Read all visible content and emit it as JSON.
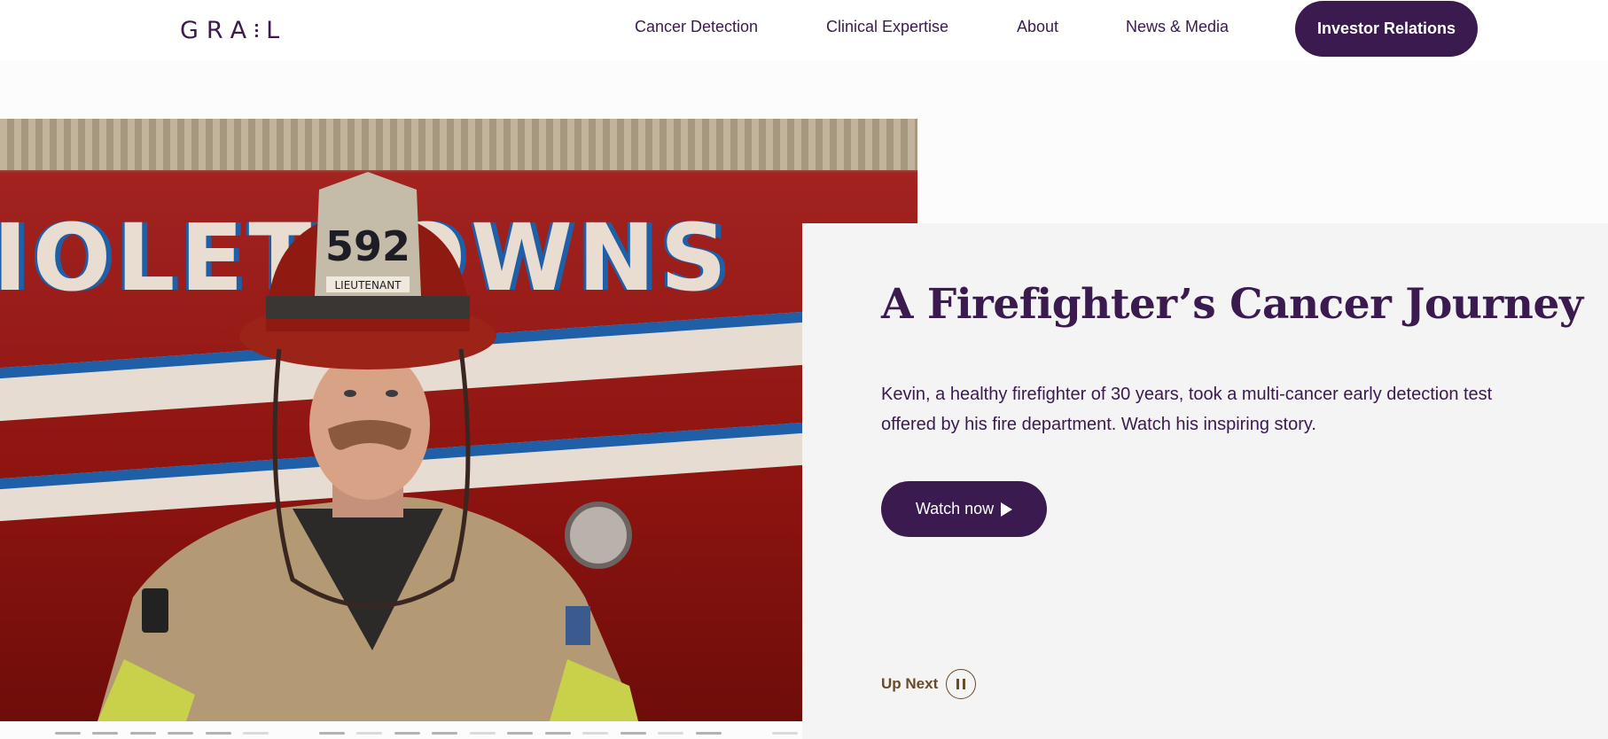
{
  "header": {
    "logo": "GRAIL",
    "nav": [
      {
        "label": "Cancer Detection"
      },
      {
        "label": "Clinical Expertise"
      },
      {
        "label": "About"
      },
      {
        "label": "News & Media"
      }
    ],
    "cta_label": "Investor Relations"
  },
  "hero": {
    "image_text": "IOLETTOWNS",
    "title": "A Firefighter’s Cancer Journey",
    "description": "Kevin, a healthy firefighter of 30 years, took a multi-cancer early detection test offered by his fire department. Watch his inspiring story.",
    "watch_label": "Watch now",
    "up_next_label": "Up Next",
    "image_alt": "Firefighter wearing helmet in front of fire truck"
  },
  "pager": {
    "segments": 18,
    "active_shades": [
      "dark",
      "dark",
      "dark",
      "dark",
      "dark",
      "light",
      "dark",
      "light",
      "dark",
      "dark",
      "light",
      "dark",
      "dark",
      "light",
      "dark",
      "light",
      "dark",
      "light"
    ]
  },
  "colors": {
    "brand": "#3a1a4f",
    "panel": "#f4f4f4",
    "accent_brown": "#6b4a2a"
  }
}
